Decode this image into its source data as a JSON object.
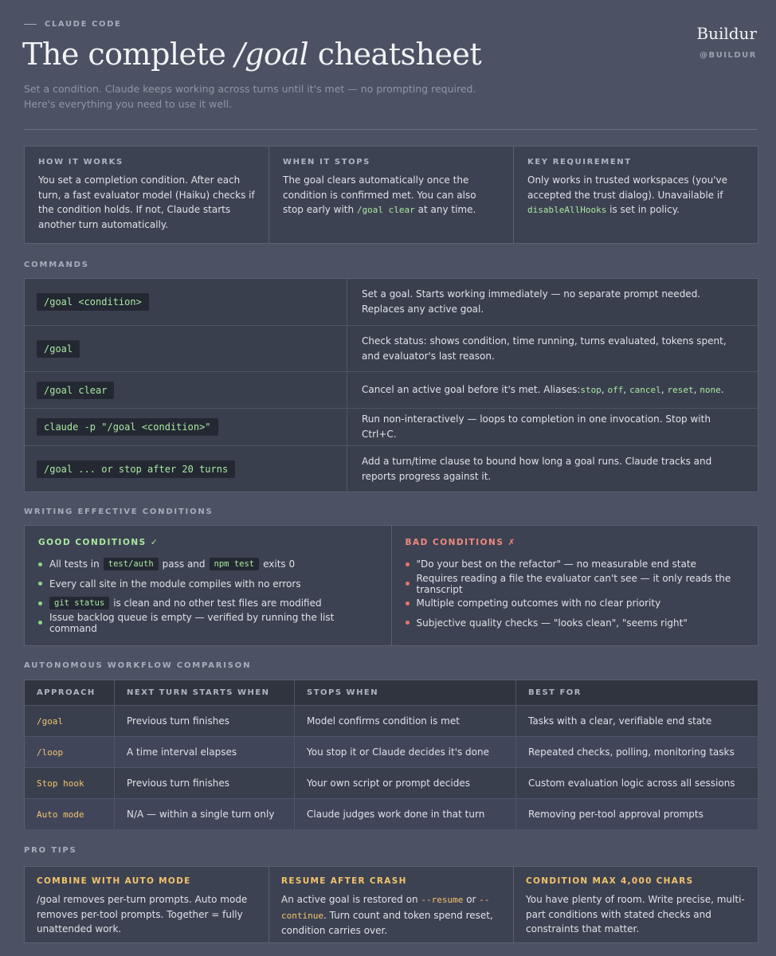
{
  "header": {
    "kicker": "CLAUDE CODE",
    "title_pre": "The complete ",
    "title_em": "/goal",
    "title_post": " cheatsheet",
    "subtitle": "Set a condition. Claude keeps working across turns until it's met — no prompting required. Here's everything you need to use it well.",
    "brand": "Buildur",
    "handle": "@BUILDUR"
  },
  "overview": {
    "how": {
      "label": "HOW IT WORKS",
      "text": "You set a completion condition. After each turn, a fast evaluator model (Haiku) checks if the condition holds. If not, Claude starts another turn automatically."
    },
    "when": {
      "label": "WHEN IT STOPS",
      "text_pre": "The goal clears automatically once the condition is confirmed met. You can also stop early with ",
      "code": "/goal clear",
      "text_post": " at any time."
    },
    "key": {
      "label": "KEY REQUIREMENT",
      "text_pre": "Only works in trusted workspaces (you've accepted the trust dialog). Unavailable if ",
      "code": "disableAllHooks",
      "text_post": " is set in policy."
    }
  },
  "commands": {
    "title": "COMMANDS",
    "rows": [
      {
        "cmd": "/goal <condition>",
        "desc": "Set a goal. Starts working immediately — no separate prompt needed. Replaces any active goal."
      },
      {
        "cmd": "/goal",
        "desc": "Check status: shows condition, time running, turns evaluated, tokens spent, and evaluator's last reason."
      },
      {
        "cmd": "/goal clear",
        "desc_pre": "Cancel an active goal before it's met. Aliases: ",
        "aliases": [
          "stop",
          "off",
          "cancel",
          "reset",
          "none"
        ],
        "desc_post": "."
      },
      {
        "cmd": "claude -p \"/goal <condition>\"",
        "desc": "Run non-interactively — loops to completion in one invocation. Stop with Ctrl+C."
      },
      {
        "cmd": "/goal ... or stop after 20 turns",
        "desc": "Add a turn/time clause to bound how long a goal runs. Claude tracks and reports progress against it."
      }
    ]
  },
  "conditions": {
    "title": "WRITING EFFECTIVE CONDITIONS",
    "good": {
      "title": "GOOD CONDITIONS ✓",
      "item1_pre": "All tests in",
      "item1_code1": "test/auth",
      "item1_mid": "pass and",
      "item1_code2": "npm test",
      "item1_post": "exits 0",
      "item2": "Every call site in the module compiles with no errors",
      "item3_code": "git status",
      "item3_post": "is clean and no other test files are modified",
      "item4": "Issue backlog queue is empty — verified by running the list command"
    },
    "bad": {
      "title": "BAD CONDITIONS ✗",
      "items": [
        "\"Do your best on the refactor\" — no measurable end state",
        "Requires reading a file the evaluator can't see — it only reads the transcript",
        "Multiple competing outcomes with no clear priority",
        "Subjective quality checks — \"looks clean\", \"seems right\""
      ]
    }
  },
  "comparison": {
    "title": "AUTONOMOUS WORKFLOW COMPARISON",
    "headers": [
      "APPROACH",
      "NEXT TURN STARTS WHEN",
      "STOPS WHEN",
      "BEST FOR"
    ],
    "rows": [
      [
        "/goal",
        "Previous turn finishes",
        "Model confirms condition is met",
        "Tasks with a clear, verifiable end state"
      ],
      [
        "/loop",
        "A time interval elapses",
        "You stop it or Claude decides it's done",
        "Repeated checks, polling, monitoring tasks"
      ],
      [
        "Stop hook",
        "Previous turn finishes",
        "Your own script or prompt decides",
        "Custom evaluation logic across all sessions"
      ],
      [
        "Auto mode",
        "N/A — within a single turn only",
        "Claude judges work done in that turn",
        "Removing per-tool approval prompts"
      ]
    ]
  },
  "tips": {
    "title": "PRO TIPS",
    "auto": {
      "label": "COMBINE WITH AUTO MODE",
      "text": "/goal removes per-turn prompts. Auto mode removes per-tool prompts. Together = fully unattended work."
    },
    "resume": {
      "label": "RESUME AFTER CRASH",
      "text_pre": "An active goal is restored on ",
      "code1": "--resume",
      "mid": " or ",
      "code2": "--continue",
      "text_post": ". Turn count and token spend reset, condition carries over."
    },
    "max": {
      "label": "CONDITION MAX 4,000 CHARS",
      "text": "You have plenty of room. Write precise, multi-part conditions with stated checks and constraints that matter."
    }
  }
}
